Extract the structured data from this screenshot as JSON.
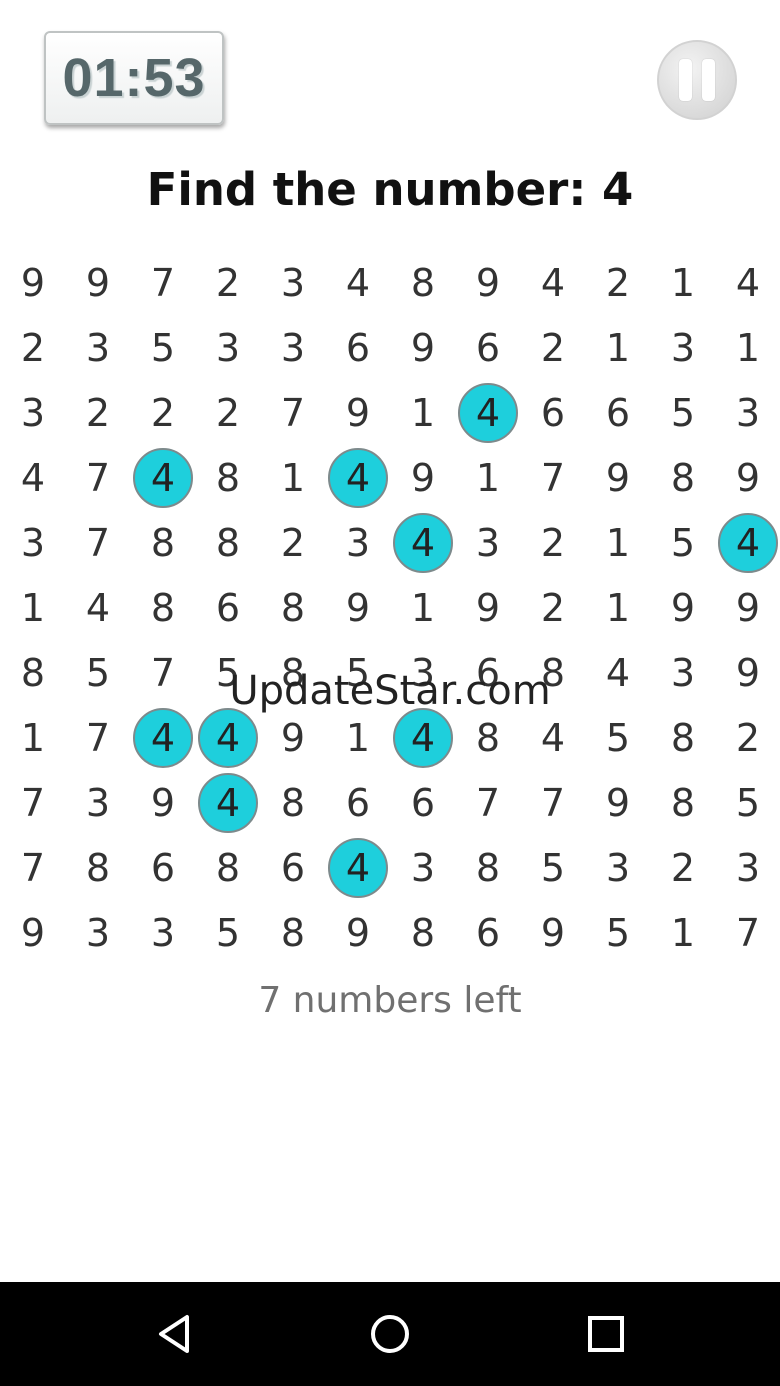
{
  "timer": {
    "value": "01:53"
  },
  "title": "Find the number: 4",
  "target": "4",
  "grid": {
    "rows": [
      [
        "9",
        "9",
        "7",
        "2",
        "3",
        "4",
        "8",
        "9",
        "4",
        "2",
        "1",
        "4"
      ],
      [
        "2",
        "3",
        "5",
        "3",
        "3",
        "6",
        "9",
        "6",
        "2",
        "1",
        "3",
        "1"
      ],
      [
        "3",
        "2",
        "2",
        "2",
        "7",
        "9",
        "1",
        "4",
        "6",
        "6",
        "5",
        "3"
      ],
      [
        "4",
        "7",
        "4",
        "8",
        "1",
        "4",
        "9",
        "1",
        "7",
        "9",
        "8",
        "9"
      ],
      [
        "3",
        "7",
        "8",
        "8",
        "2",
        "3",
        "4",
        "3",
        "2",
        "1",
        "5",
        "4"
      ],
      [
        "1",
        "4",
        "8",
        "6",
        "8",
        "9",
        "1",
        "9",
        "2",
        "1",
        "9",
        "9"
      ],
      [
        "8",
        "5",
        "7",
        "5",
        "8",
        "5",
        "3",
        "6",
        "8",
        "4",
        "3",
        "9"
      ],
      [
        "1",
        "7",
        "4",
        "4",
        "9",
        "1",
        "4",
        "8",
        "4",
        "5",
        "8",
        "2"
      ],
      [
        "7",
        "3",
        "9",
        "4",
        "8",
        "6",
        "6",
        "7",
        "7",
        "9",
        "8",
        "5"
      ],
      [
        "7",
        "8",
        "6",
        "8",
        "6",
        "4",
        "3",
        "8",
        "5",
        "3",
        "2",
        "3"
      ],
      [
        "9",
        "3",
        "3",
        "5",
        "8",
        "9",
        "8",
        "6",
        "9",
        "5",
        "1",
        "7"
      ]
    ],
    "found": [
      [
        2,
        7
      ],
      [
        3,
        2
      ],
      [
        3,
        5
      ],
      [
        4,
        6
      ],
      [
        4,
        11
      ],
      [
        7,
        2
      ],
      [
        7,
        3
      ],
      [
        7,
        6
      ],
      [
        8,
        3
      ],
      [
        9,
        5
      ]
    ]
  },
  "watermark": "UpdateStar.com",
  "status": "7 numbers left",
  "colors": {
    "found_fill": "#1ecfdc",
    "found_border": "#7d8a8c"
  },
  "nav": {
    "back": "back-icon",
    "home": "home-icon",
    "recents": "recents-icon"
  }
}
